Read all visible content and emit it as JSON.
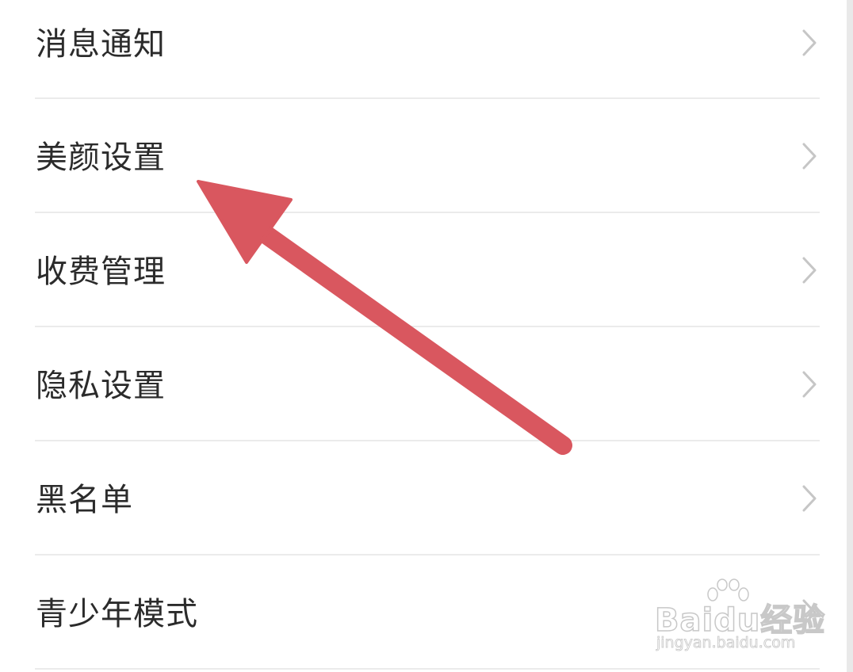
{
  "settings": {
    "items": [
      {
        "label": "消息通知"
      },
      {
        "label": "美颜设置"
      },
      {
        "label": "收费管理"
      },
      {
        "label": "隐私设置"
      },
      {
        "label": "黑名单"
      },
      {
        "label": "青少年模式"
      }
    ],
    "chevron_icon": "chevron-right-icon"
  },
  "annotation": {
    "icon": "arrow-pointer-icon",
    "color": "#d9575f"
  },
  "watermark": {
    "brand": "Baidu经验",
    "url": "jingyan.baidu.com"
  },
  "colors": {
    "background": "#ffffff",
    "label_text": "#2b2b2b",
    "chevron": "#c6c6c6",
    "divider": "#ebebeb"
  }
}
